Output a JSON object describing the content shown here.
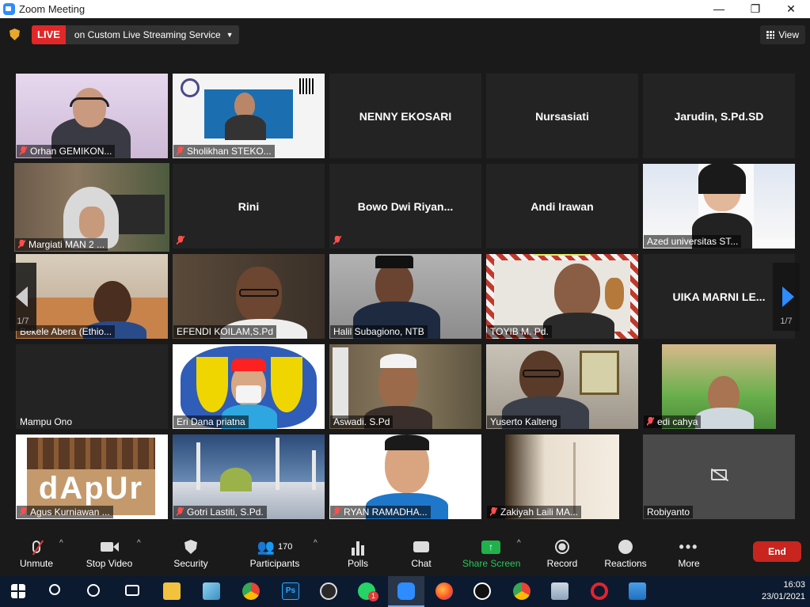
{
  "window": {
    "title": "Zoom Meeting",
    "minimize": "—",
    "maximize": "❐",
    "close": "✕"
  },
  "topbar": {
    "live_badge": "LIVE",
    "live_text": "on Custom Live Streaming Service",
    "view_label": "View"
  },
  "gallery": {
    "page_left": "1/7",
    "page_right": "1/7",
    "tiles": [
      {
        "name": "Orhan GEMIKON...",
        "muted": true,
        "video": true
      },
      {
        "name": "Sholikhan STEKO...",
        "muted": true,
        "video": true
      },
      {
        "name": "NENNY EKOSARI",
        "muted": false,
        "video": false
      },
      {
        "name": "Nursasiati",
        "muted": false,
        "video": false
      },
      {
        "name": "Jarudin, S.Pd.SD",
        "muted": false,
        "video": false
      },
      {
        "name": "Margiati MAN 2 ...",
        "muted": true,
        "video": true,
        "active": true
      },
      {
        "name": "Rini",
        "muted": true,
        "video": false
      },
      {
        "name": "Bowo  Dwi  Riyan...",
        "muted": true,
        "video": false
      },
      {
        "name": "Andi Irawan",
        "muted": false,
        "video": false
      },
      {
        "name": "Azed universitas ST...",
        "muted": false,
        "video": true
      },
      {
        "name": "Bekele Abera (Ethio...",
        "muted": false,
        "video": true
      },
      {
        "name": "EFENDI KOILAM,S.Pd",
        "muted": false,
        "video": true
      },
      {
        "name": "Halil Subagiono, NTB",
        "muted": false,
        "video": true
      },
      {
        "name": "TOYIB M. Pd.",
        "muted": false,
        "video": true
      },
      {
        "name": "UIKA MARNI LE...",
        "muted": false,
        "video": false
      },
      {
        "name": "Mampu Ono",
        "muted": false,
        "video": false
      },
      {
        "name": "Eri Dana priatna",
        "muted": false,
        "video": true
      },
      {
        "name": "Aswadi. S.Pd",
        "muted": false,
        "video": true
      },
      {
        "name": "Yuserto Kalteng",
        "muted": false,
        "video": true
      },
      {
        "name": "edi cahya",
        "muted": true,
        "video": true
      },
      {
        "name": "Agus Kurniawan ...",
        "muted": true,
        "video": true
      },
      {
        "name": "Gotri Lastiti, S.Pd.",
        "muted": true,
        "video": true
      },
      {
        "name": "RYAN RAMADHA...",
        "muted": true,
        "video": true
      },
      {
        "name": "Zakiyah Laili MA...",
        "muted": true,
        "video": true
      },
      {
        "name": "Robiyanto",
        "muted": false,
        "video": false
      }
    ],
    "dapur_text": "dApUr"
  },
  "toolbar": {
    "unmute": "Unmute",
    "stop_video": "Stop Video",
    "security": "Security",
    "participants": "Participants",
    "participants_count": "170",
    "polls": "Polls",
    "chat": "Chat",
    "share_screen": "Share Screen",
    "record": "Record",
    "reactions": "Reactions",
    "more": "More",
    "end": "End"
  },
  "taskbar": {
    "time": "16:03",
    "date": "23/01/2021",
    "whatsapp_badge": "1"
  },
  "colors": {
    "live": "#e02828",
    "share": "#21b14c",
    "end": "#c9251f",
    "active_speaker": "#c8e35a",
    "nav_arrow": "#2d8cff"
  }
}
